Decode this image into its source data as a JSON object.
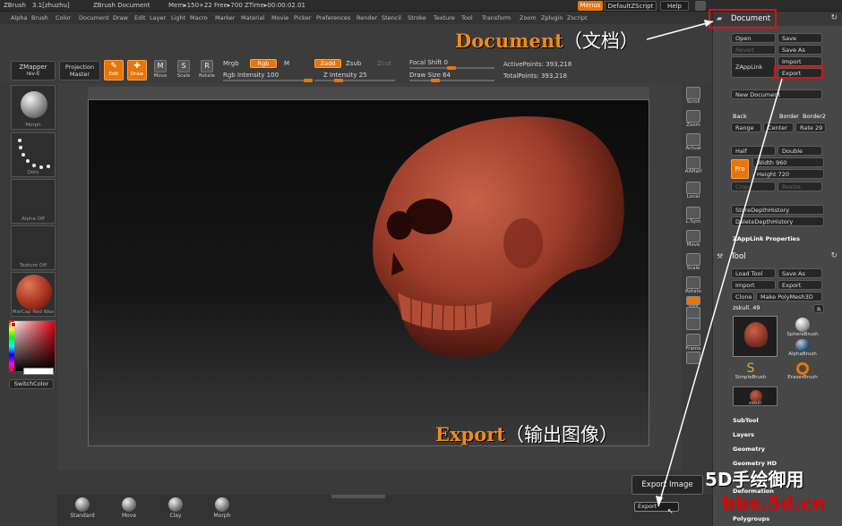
{
  "titlebar": {
    "app": "ZBrush",
    "version": "3.1[zhuzhu]",
    "doc": "ZBrush Document",
    "mem": "Mem▸150+22 Free▸700 ZTime▸00:00:02.01",
    "menus_btn": "Menus",
    "script_btn": "DefaultZScript",
    "help_btn": "Help"
  },
  "menubar": [
    "Alpha",
    "Brush",
    "Color",
    "Document",
    "Draw",
    "Edit",
    "Layer",
    "Light",
    "Macro",
    "Marker",
    "Material",
    "Movie",
    "Picker",
    "Preferences",
    "Render",
    "Stencil",
    "Stroke",
    "Texture",
    "Tool",
    "Transform",
    "Zoom",
    "Zplugin",
    "Zscript"
  ],
  "toolbar": {
    "zmapper": "ZMapper",
    "zmapper_sub": "rev-E",
    "projection": "Projection",
    "projection_sub": "Master",
    "edit": "Edit",
    "draw": "Draw",
    "move": "Move",
    "scale": "Scale",
    "rotate": "Rotate",
    "mrgb": "Mrgb",
    "rgb": "Rgb",
    "m": "M",
    "rgb_intensity": "Rgb Intensity 100",
    "zadd": "Zadd",
    "zsub": "Zsub",
    "zcut": "Zcut",
    "z_intensity": "Z Intensity 25",
    "focal_shift": "Focal Shift 0",
    "draw_size": "Draw Size 64",
    "active_points": "ActivePoints: 393,218",
    "total_points": "TotalPoints: 393,218"
  },
  "leftpal": {
    "morph": "Morph",
    "dots": "Dots",
    "alpha": "Alpha Off",
    "texture": "Texture Off",
    "matcap": "MatCap Red Wax",
    "switchcolor": "SwitchColor"
  },
  "rbar": [
    "Scroll",
    "Zoom",
    "Actual",
    "AAHalf",
    "Local",
    "L.Sym",
    "Move",
    "Scale",
    "Rotate",
    "XYZ",
    "",
    "",
    "Frame",
    "",
    "Poly",
    "Transp",
    "Ghost",
    "Xpose"
  ],
  "rpanel": {
    "document_title": "Document",
    "open": "Open",
    "save": "Save",
    "revert": "Revert",
    "save_as": "Save As",
    "zapplink": "ZAppLink",
    "import": "Import",
    "export": "Export",
    "new_document": "New Document",
    "back": "Back",
    "border": "Border",
    "border2": "Border2",
    "range": "Range",
    "center": "Center",
    "rate": "Rate 29",
    "half": "Half",
    "double": "Double",
    "pro": "Pro",
    "width": "Width 960",
    "height": "Height 720",
    "crop": "Crop",
    "resize": "Resize",
    "store_depth": "StoreDepthHistory",
    "delete_depth": "DeleteDepthHistory",
    "zapplink_props": "ZAppLink Properties",
    "tool_title": "Tool",
    "load_tool": "Load Tool",
    "save_as_tool": "Save As",
    "import_tool": "Import",
    "export_tool": "Export",
    "clone": "Clone",
    "make_polymesh": "Make PolyMesh3D",
    "zskull": "zskull. 49",
    "r": "R",
    "tools": [
      {
        "name": "zskull",
        "caption": "zskull"
      },
      {
        "name": "SphereBrush",
        "caption": "SphereBrush"
      },
      {
        "name": "AlphaBrush",
        "caption": "AlphaBrush"
      },
      {
        "name": "SimpleBrush",
        "caption": "SimpleBrush"
      },
      {
        "name": "EraserBrush",
        "caption": "EraserBrush"
      },
      {
        "name": "zskull2",
        "caption": "zskull"
      }
    ],
    "subtool": "SubTool",
    "layers": "Layers",
    "geometry": "Geometry",
    "geometry_hd": "Geometry HD",
    "deformation": "Deformation",
    "polygroups": "Polygroups"
  },
  "bottom": {
    "brushes": [
      "Standard",
      "Move",
      "Clay",
      "Morph"
    ],
    "export_image_tip": "Export Image",
    "export_btn": "Export"
  },
  "annotations": {
    "document": "Document",
    "document_cn": "（文档）",
    "export": "Export",
    "export_cn": "（输出图像）"
  },
  "watermark": {
    "line1": "5D手绘御用",
    "line2": "bbs.5d.cn"
  },
  "colors": {
    "accent": "#e8750a",
    "annotation": "#f08a1c",
    "highlight_box": "#e01010",
    "skull": "#9a3a28"
  }
}
